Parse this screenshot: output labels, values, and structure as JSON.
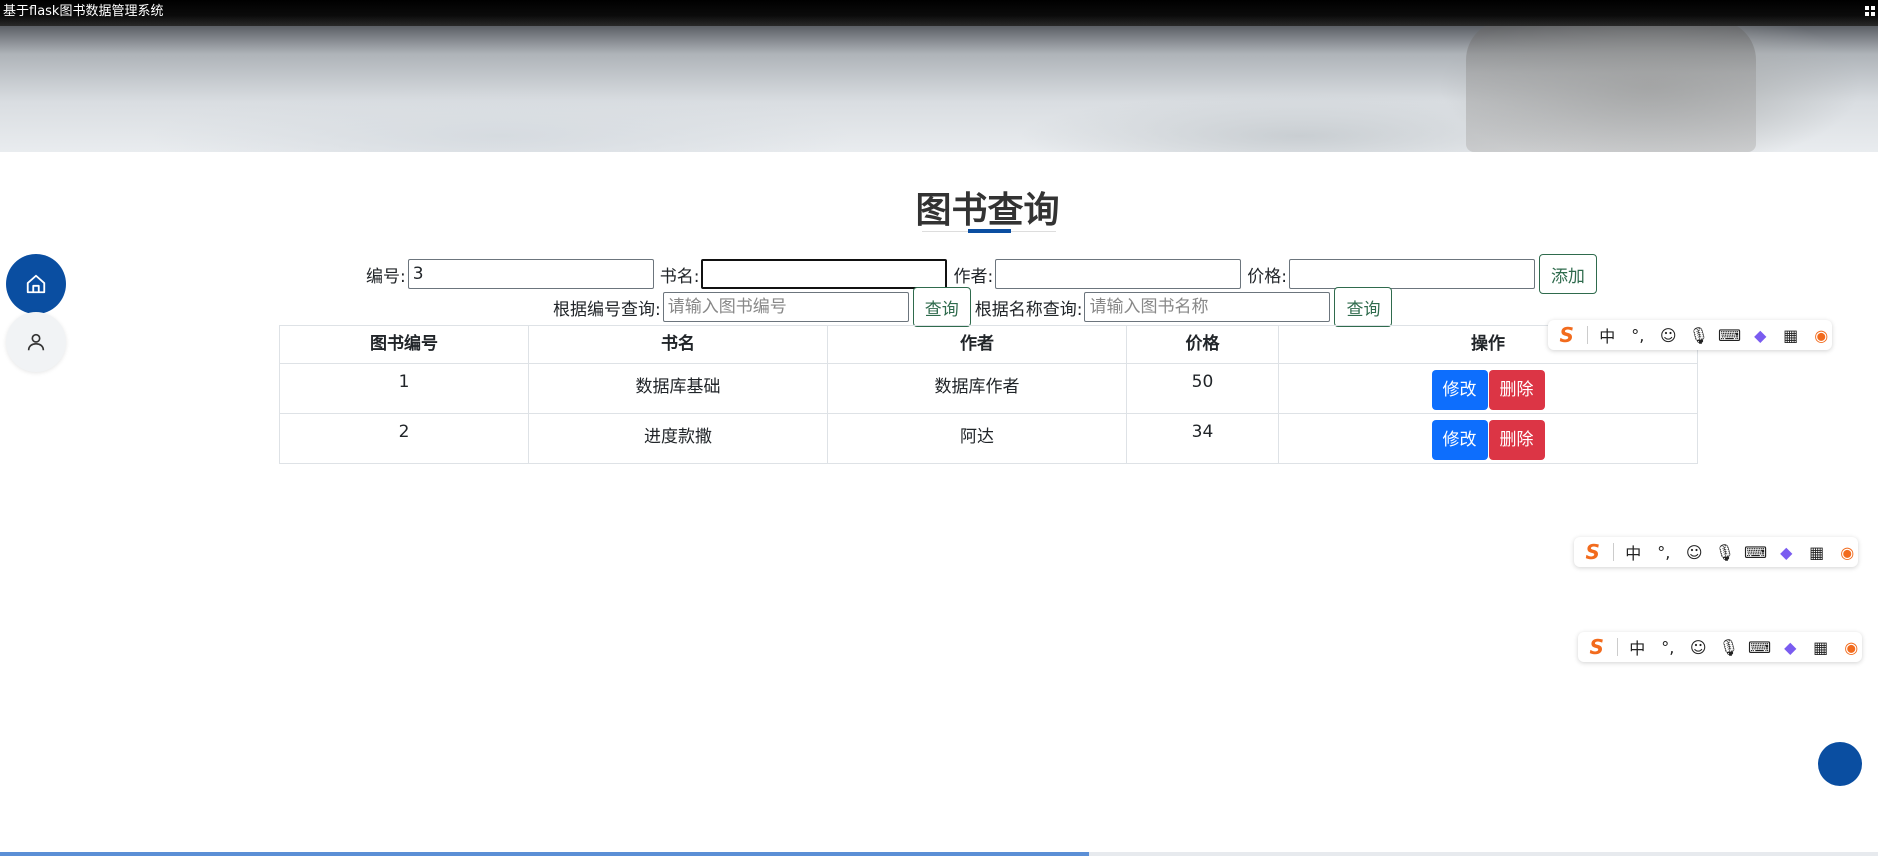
{
  "window": {
    "title": "基于flask图书数据管理系统"
  },
  "page": {
    "title": "图书查询"
  },
  "form": {
    "id_label": "编号:",
    "id_value": "3",
    "name_label": "书名:",
    "name_value": "",
    "author_label": "作者:",
    "author_value": "",
    "price_label": "价格:",
    "price_value": "",
    "add_button": "添加"
  },
  "search": {
    "by_id_label": "根据编号查询:",
    "by_id_placeholder": "请输入图书编号",
    "by_id_button": "查询",
    "by_name_label": "根据名称查询:",
    "by_name_placeholder": "请输入图书名称",
    "by_name_button": "查询"
  },
  "table": {
    "headers": [
      "图书编号",
      "书名",
      "作者",
      "价格",
      "操作"
    ],
    "rows": [
      {
        "id": "1",
        "name": "数据库基础",
        "author": "数据库作者",
        "price": "50"
      },
      {
        "id": "2",
        "name": "进度款撒",
        "author": "阿达",
        "price": "34"
      }
    ],
    "edit_label": "修改",
    "delete_label": "删除"
  },
  "nav": {
    "home_icon": "home-icon",
    "user_icon": "user-icon"
  },
  "ime": {
    "chinese_mode": "中",
    "punct": "°,"
  },
  "progress": {
    "fraction": 0.58
  },
  "colors": {
    "primary": "#0d6efd",
    "danger": "#dc3545",
    "outline": "#2f6b4d",
    "brand": "#0a4ea1"
  }
}
